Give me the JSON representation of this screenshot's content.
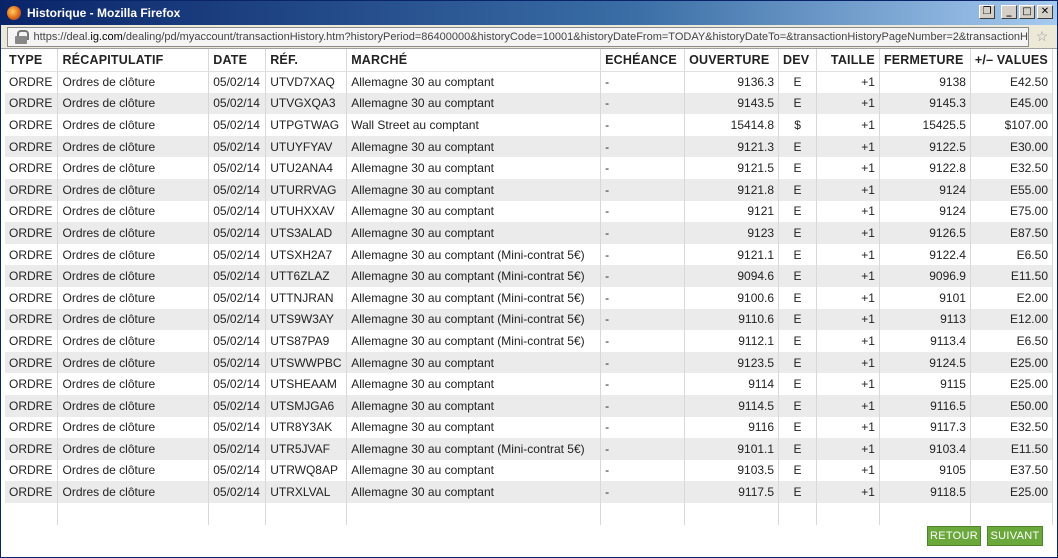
{
  "window": {
    "title": "Historique - Mozilla Firefox",
    "buttons": [
      "restore",
      "minimize",
      "maximize",
      "close"
    ]
  },
  "urlbar": {
    "domain_prefix": "https://deal.",
    "domain_bold": "ig.com",
    "path": "/dealing/pd/myaccount/transactionHistory.htm?historyPeriod=86400000&historyCode=10001&historyDateFrom=TODAY&historyDateTo=&transactionHistoryPageNumber=2&transactionH"
  },
  "table": {
    "columns": [
      "TYPE",
      "RÉCAPITULATIF",
      "DATE",
      "RÉF.",
      "MARCHÉ",
      "ECHÉANCE",
      "OUVERTURE",
      "DEV",
      "TAILLE",
      "FERMETURE",
      "+/– VALUES"
    ],
    "rows": [
      [
        "ORDRE",
        "Ordres de clôture",
        "05/02/14",
        "UTVD7XAQ",
        "Allemagne 30 au comptant",
        "-",
        "9136.3",
        "E",
        "+1",
        "9138",
        "E42.50"
      ],
      [
        "ORDRE",
        "Ordres de clôture",
        "05/02/14",
        "UTVGXQA3",
        "Allemagne 30 au comptant",
        "-",
        "9143.5",
        "E",
        "+1",
        "9145.3",
        "E45.00"
      ],
      [
        "ORDRE",
        "Ordres de clôture",
        "05/02/14",
        "UTPGTWAG",
        "Wall Street au comptant",
        "-",
        "15414.8",
        "$",
        "+1",
        "15425.5",
        "$107.00"
      ],
      [
        "ORDRE",
        "Ordres de clôture",
        "05/02/14",
        "UTUYFYAV",
        "Allemagne 30 au comptant",
        "-",
        "9121.3",
        "E",
        "+1",
        "9122.5",
        "E30.00"
      ],
      [
        "ORDRE",
        "Ordres de clôture",
        "05/02/14",
        "UTU2ANA4",
        "Allemagne 30 au comptant",
        "-",
        "9121.5",
        "E",
        "+1",
        "9122.8",
        "E32.50"
      ],
      [
        "ORDRE",
        "Ordres de clôture",
        "05/02/14",
        "UTURRVAG",
        "Allemagne 30 au comptant",
        "-",
        "9121.8",
        "E",
        "+1",
        "9124",
        "E55.00"
      ],
      [
        "ORDRE",
        "Ordres de clôture",
        "05/02/14",
        "UTUHXXAV",
        "Allemagne 30 au comptant",
        "-",
        "9121",
        "E",
        "+1",
        "9124",
        "E75.00"
      ],
      [
        "ORDRE",
        "Ordres de clôture",
        "05/02/14",
        "UTS3ALAD",
        "Allemagne 30 au comptant",
        "-",
        "9123",
        "E",
        "+1",
        "9126.5",
        "E87.50"
      ],
      [
        "ORDRE",
        "Ordres de clôture",
        "05/02/14",
        "UTSXH2A7",
        "Allemagne 30 au comptant (Mini-contrat 5€)",
        "-",
        "9121.1",
        "E",
        "+1",
        "9122.4",
        "E6.50"
      ],
      [
        "ORDRE",
        "Ordres de clôture",
        "05/02/14",
        "UTT6ZLAZ",
        "Allemagne 30 au comptant (Mini-contrat 5€)",
        "-",
        "9094.6",
        "E",
        "+1",
        "9096.9",
        "E11.50"
      ],
      [
        "ORDRE",
        "Ordres de clôture",
        "05/02/14",
        "UTTNJRAN",
        "Allemagne 30 au comptant (Mini-contrat 5€)",
        "-",
        "9100.6",
        "E",
        "+1",
        "9101",
        "E2.00"
      ],
      [
        "ORDRE",
        "Ordres de clôture",
        "05/02/14",
        "UTS9W3AY",
        "Allemagne 30 au comptant (Mini-contrat 5€)",
        "-",
        "9110.6",
        "E",
        "+1",
        "9113",
        "E12.00"
      ],
      [
        "ORDRE",
        "Ordres de clôture",
        "05/02/14",
        "UTS87PA9",
        "Allemagne 30 au comptant (Mini-contrat 5€)",
        "-",
        "9112.1",
        "E",
        "+1",
        "9113.4",
        "E6.50"
      ],
      [
        "ORDRE",
        "Ordres de clôture",
        "05/02/14",
        "UTSWWPBC",
        "Allemagne 30 au comptant",
        "-",
        "9123.5",
        "E",
        "+1",
        "9124.5",
        "E25.00"
      ],
      [
        "ORDRE",
        "Ordres de clôture",
        "05/02/14",
        "UTSHEAAM",
        "Allemagne 30 au comptant",
        "-",
        "9114",
        "E",
        "+1",
        "9115",
        "E25.00"
      ],
      [
        "ORDRE",
        "Ordres de clôture",
        "05/02/14",
        "UTSMJGA6",
        "Allemagne 30 au comptant",
        "-",
        "9114.5",
        "E",
        "+1",
        "9116.5",
        "E50.00"
      ],
      [
        "ORDRE",
        "Ordres de clôture",
        "05/02/14",
        "UTR8Y3AK",
        "Allemagne 30 au comptant",
        "-",
        "9116",
        "E",
        "+1",
        "9117.3",
        "E32.50"
      ],
      [
        "ORDRE",
        "Ordres de clôture",
        "05/02/14",
        "UTR5JVAF",
        "Allemagne 30 au comptant (Mini-contrat 5€)",
        "-",
        "9101.1",
        "E",
        "+1",
        "9103.4",
        "E11.50"
      ],
      [
        "ORDRE",
        "Ordres de clôture",
        "05/02/14",
        "UTRWQ8AP",
        "Allemagne 30 au comptant",
        "-",
        "9103.5",
        "E",
        "+1",
        "9105",
        "E37.50"
      ],
      [
        "ORDRE",
        "Ordres de clôture",
        "05/02/14",
        "UTRXLVAL",
        "Allemagne 30 au comptant",
        "-",
        "9117.5",
        "E",
        "+1",
        "9118.5",
        "E25.00"
      ]
    ]
  },
  "footer": {
    "back_label": "RETOUR",
    "next_label": "SUIVANT"
  }
}
